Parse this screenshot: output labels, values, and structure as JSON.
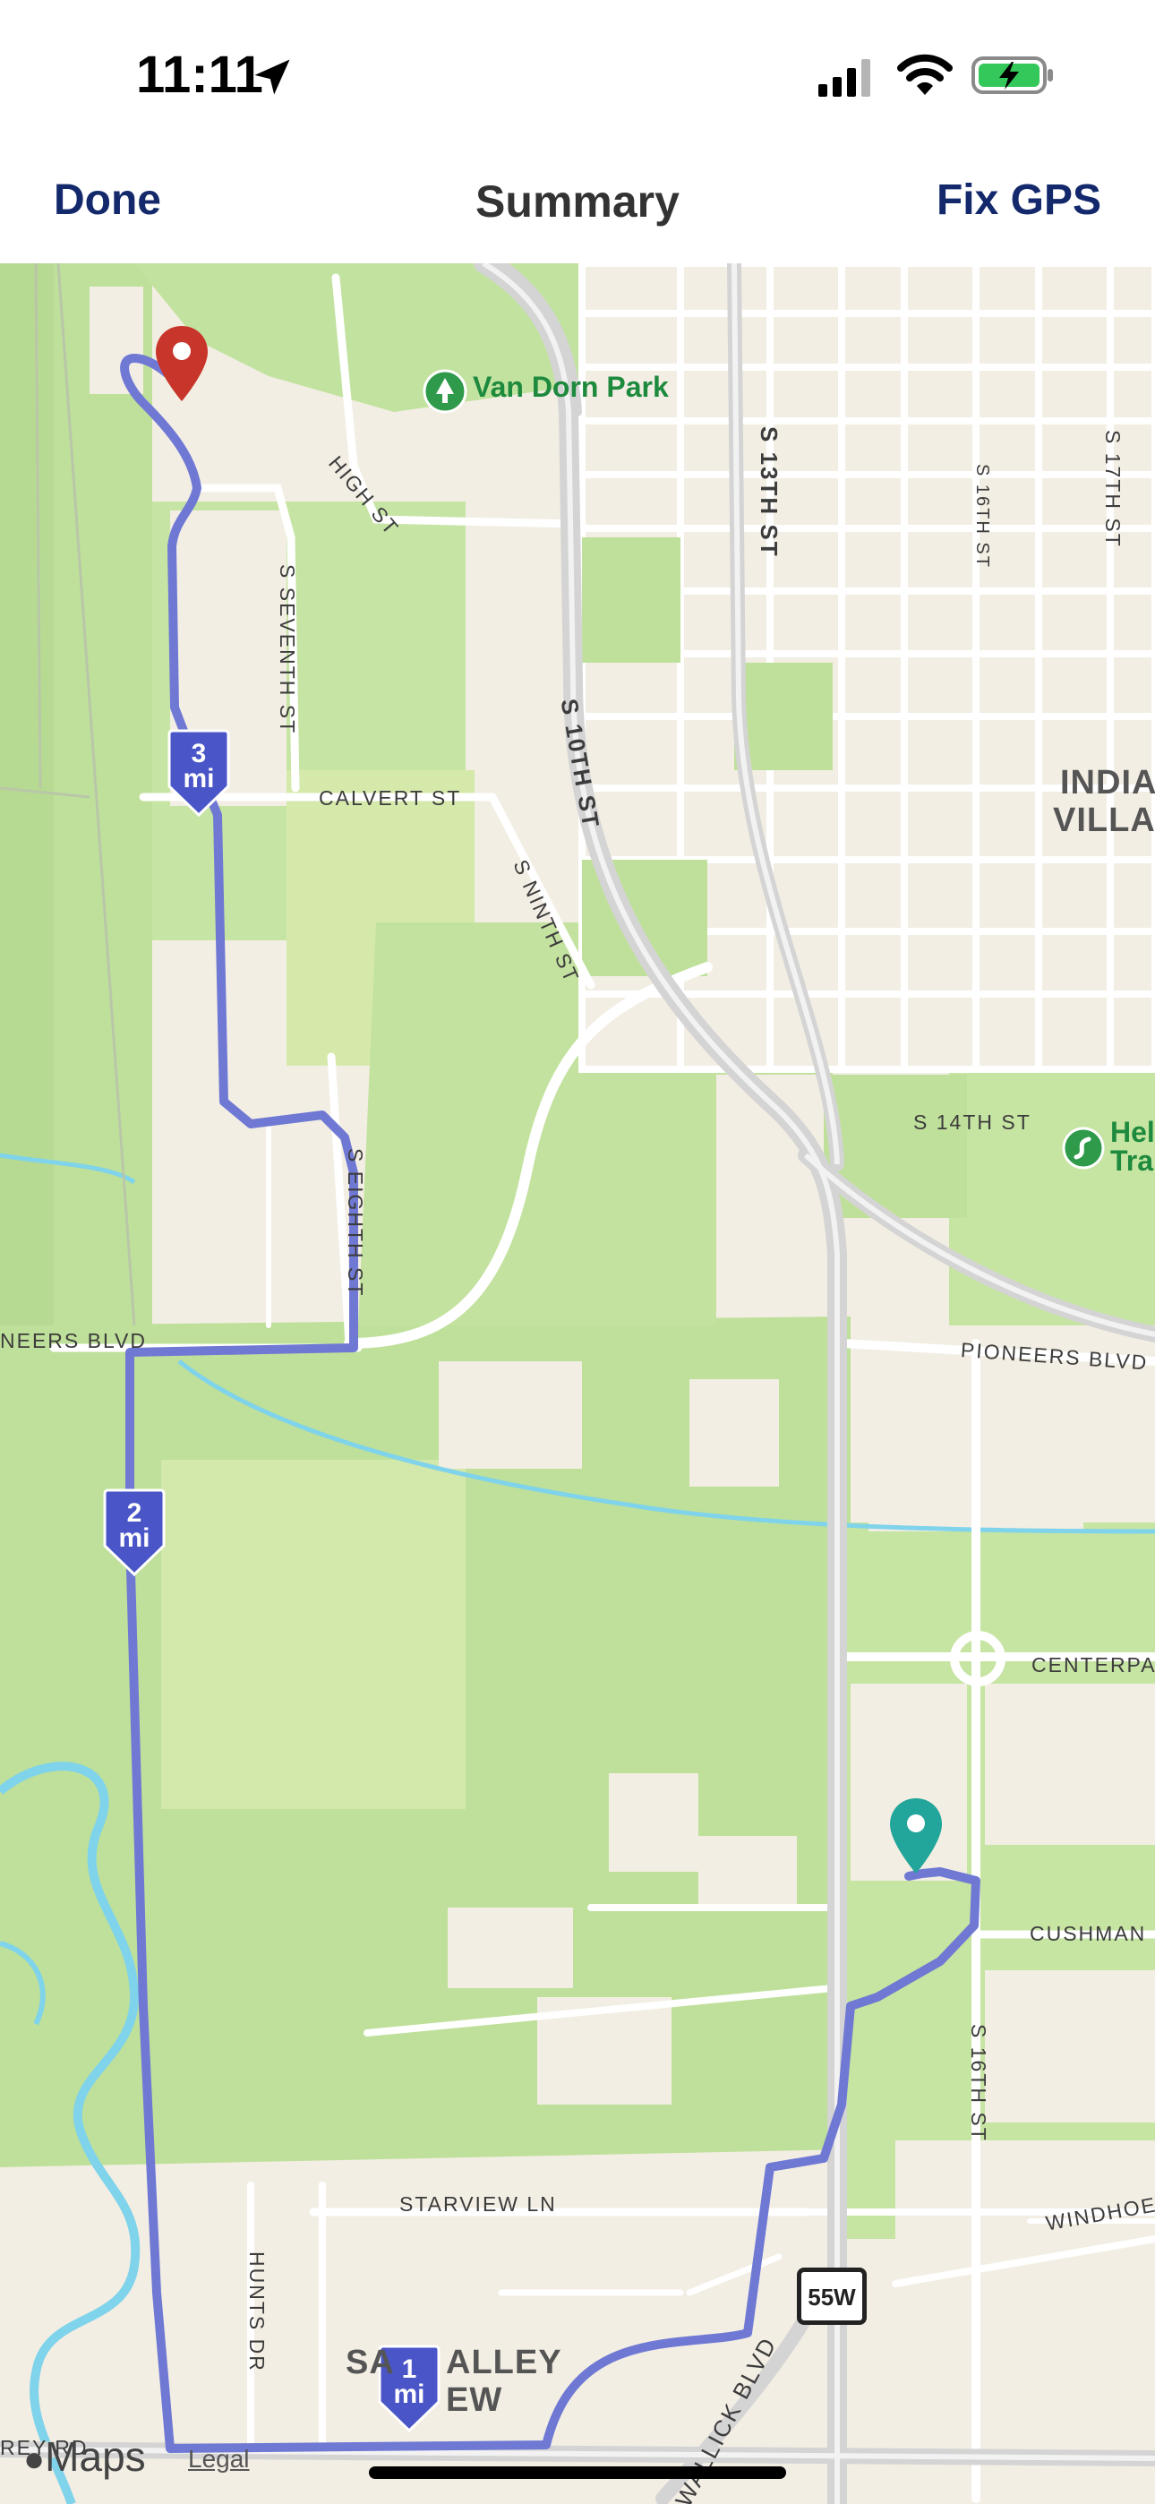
{
  "status_bar": {
    "time": "11:11",
    "icons": [
      "location-arrow-icon",
      "cellular-signal-icon",
      "wifi-icon",
      "battery-charging-icon"
    ]
  },
  "nav": {
    "left_button": "Done",
    "title": "Summary",
    "right_button": "Fix GPS"
  },
  "map": {
    "poi": [
      "Van Dorn Park",
      "Hel",
      "Tra"
    ],
    "area_labels": [
      "INDIAN",
      "VILLAG",
      "SA",
      "ALLEY",
      "EW"
    ],
    "roads": {
      "high": "HIGH ST",
      "seventh": "S SEVENTH ST",
      "calvert": "CALVERT ST",
      "tenth": "S 10TH ST",
      "ninth": "S NINTH ST",
      "thirteenth": "S 13TH ST",
      "sixteenth_top": "S 16TH ST",
      "seventeenth": "S 17TH ST",
      "fourteenth": "S 14TH ST",
      "eighth": "S EIGHTH ST",
      "pioneers_left": "NEERS BLVD",
      "pioneers_right": "PIONEERS BLVD",
      "centerpa": "CENTERPA",
      "cushman": "CUSHMAN",
      "sixteenth_bottom": "S 16TH ST",
      "windhoek": "WINDHOEK",
      "starview": "STARVIEW LN",
      "hunts": "HUNTS DR",
      "wallick": "WALLICK BLVD",
      "rey": "REY RD"
    },
    "highway_shield": "55W",
    "mile_markers": [
      {
        "num": "3",
        "unit": "mi"
      },
      {
        "num": "2",
        "unit": "mi"
      },
      {
        "num": "1",
        "unit": "mi"
      }
    ],
    "attribution": {
      "brand": "Maps",
      "legal": "Legal"
    },
    "colors": {
      "park": "#bfe09a",
      "land": "#f3eee4",
      "route": "#6f79d4",
      "start_pin": "#22a59a",
      "end_pin": "#c8352a",
      "water": "#7fd3ea",
      "mile_marker": "#4a55c8"
    }
  }
}
